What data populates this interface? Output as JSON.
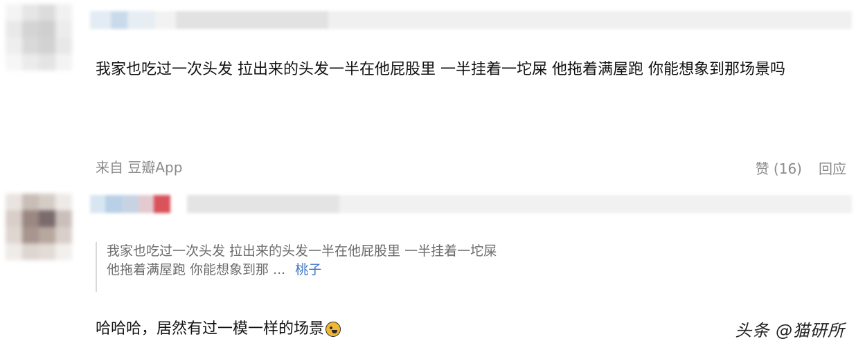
{
  "comments": [
    {
      "text": "我家也吃过一次头发 拉出来的头发一半在他屁股里 一半挂着一坨屎 他拖着满屋跑 你能想象到那场景吗",
      "source_prefix": "来自",
      "source_app": "豆瓣App",
      "like_label": "赞 (16)",
      "reply_label": "回应"
    },
    {
      "quote_line1": "我家也吃过一次头发 拉出来的头发一半在他屁股里 一半挂着一坨屎",
      "quote_line2": "他拖着满屋跑 你能想象到那 ...",
      "quote_author": "桃子",
      "text": "哈哈哈，居然有过一模一样的场景",
      "emoji": "laughing-emoji"
    }
  ],
  "watermark": "头条 @猫研所",
  "colors": {
    "link": "#3f74c4",
    "meta": "#8a8a8a",
    "emoji": "#f2b632"
  }
}
